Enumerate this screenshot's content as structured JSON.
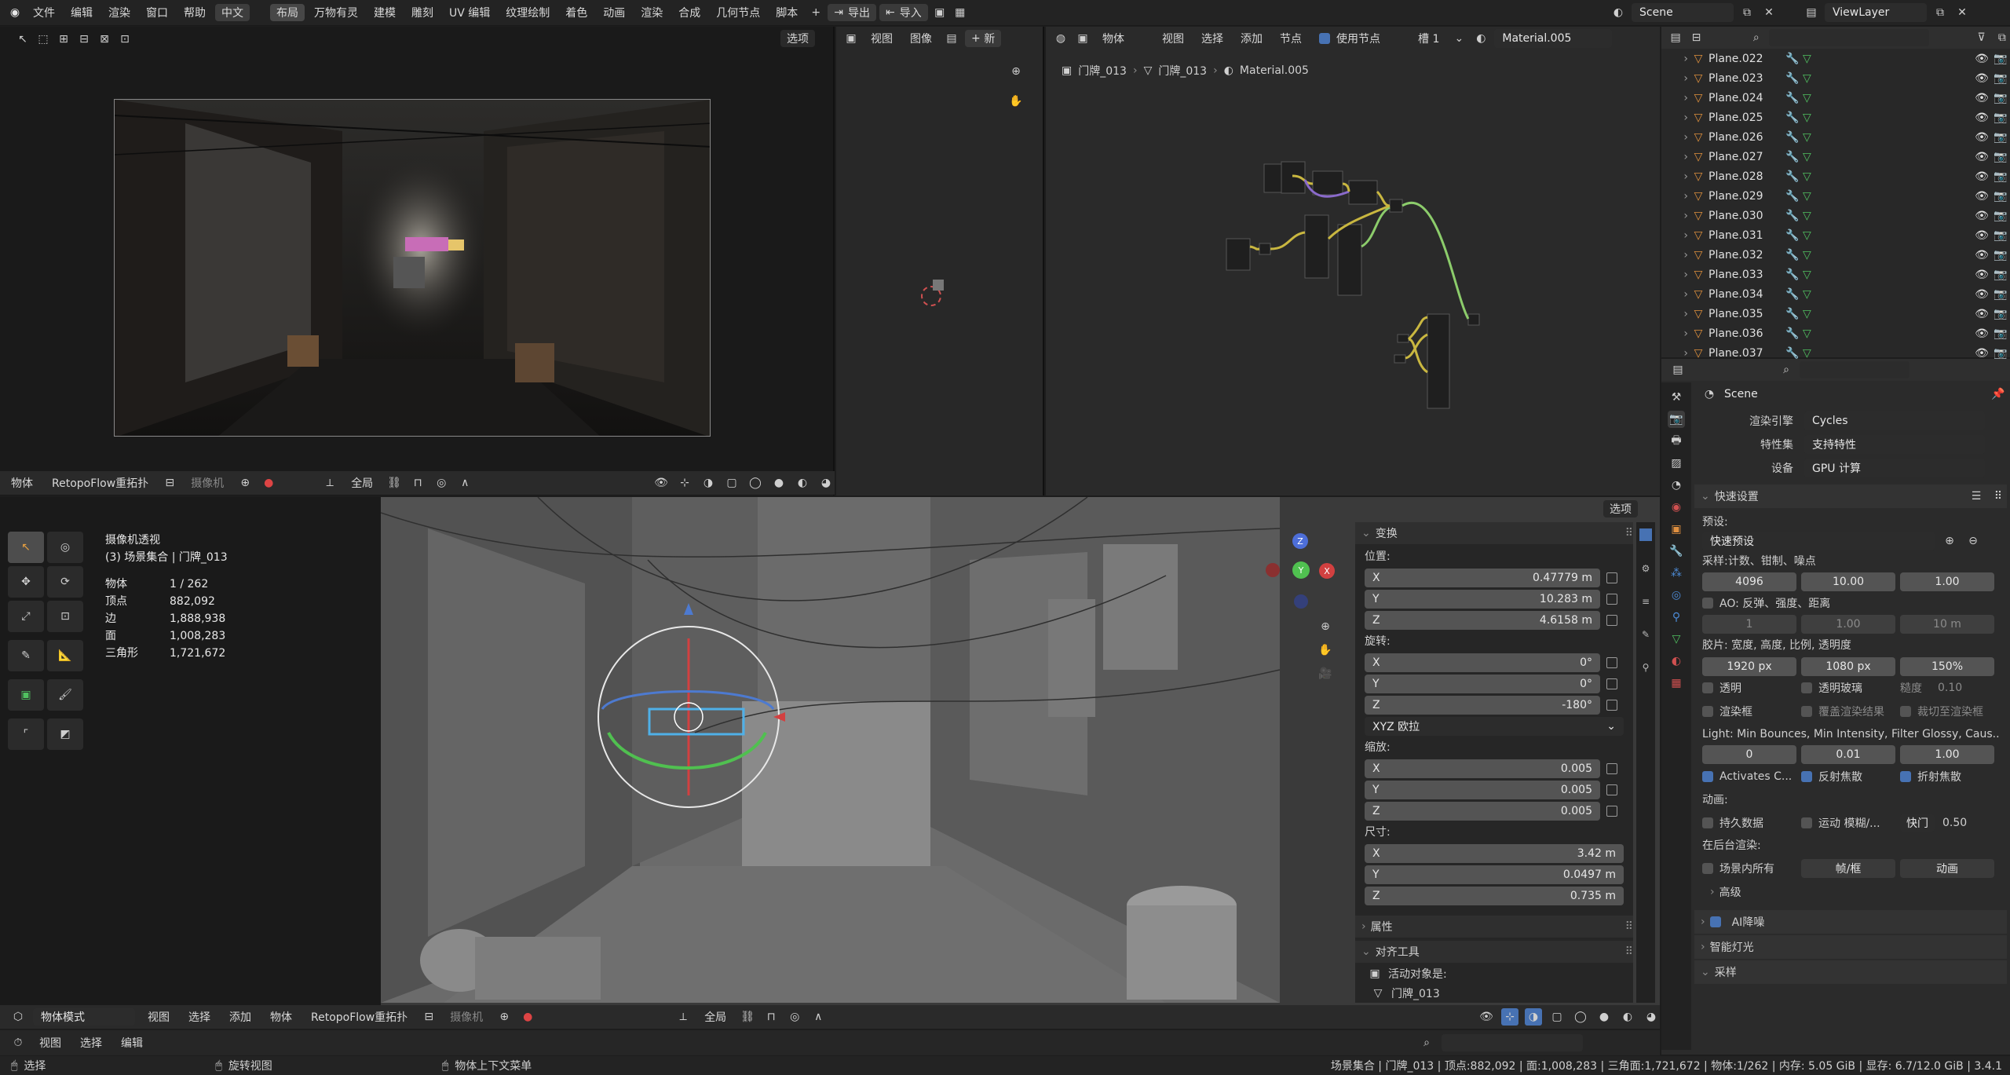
{
  "topbar": {
    "menus": [
      "文件",
      "编辑",
      "渲染",
      "窗口",
      "帮助",
      "中文"
    ],
    "workspaces": [
      "布局",
      "万物有灵",
      "建模",
      "雕刻",
      "UV 编辑",
      "纹理绘制",
      "着色",
      "动画",
      "渲染",
      "合成",
      "几何节点",
      "脚本"
    ],
    "export_label": "导出",
    "import_label": "导入",
    "scene": "Scene",
    "view_layer": "ViewLayer"
  },
  "camera_view": {
    "options_label": "选项",
    "header_items": [
      "物体",
      "RetopoFlow重拓扑",
      "摄像机",
      "全局"
    ]
  },
  "image_editor": {
    "menus": [
      "视图",
      "图像"
    ],
    "new_label": "新"
  },
  "node_editor": {
    "object_type": "物体",
    "menus": [
      "视图",
      "选择",
      "添加",
      "节点"
    ],
    "use_nodes_label": "使用节点",
    "slot": "槽 1",
    "material": "Material.005",
    "breadcrumb": [
      "门牌_013",
      "门牌_013",
      "Material.005"
    ]
  },
  "outliner": {
    "items": [
      "Plane.022",
      "Plane.023",
      "Plane.024",
      "Plane.025",
      "Plane.026",
      "Plane.027",
      "Plane.028",
      "Plane.029",
      "Plane.030",
      "Plane.031",
      "Plane.032",
      "Plane.033",
      "Plane.034",
      "Plane.035",
      "Plane.036",
      "Plane.037"
    ]
  },
  "viewport": {
    "title": "摄像机透视",
    "collection": "(3) 场景集合 | 门牌_013",
    "stats": [
      {
        "label": "物体",
        "value": "1 / 262"
      },
      {
        "label": "顶点",
        "value": "882,092"
      },
      {
        "label": "边",
        "value": "1,888,938"
      },
      {
        "label": "面",
        "value": "1,008,283"
      },
      {
        "label": "三角形",
        "value": "1,721,672"
      }
    ],
    "options_label": "选项"
  },
  "npanel": {
    "transform_title": "变换",
    "location_label": "位置:",
    "location": [
      {
        "axis": "X",
        "value": "0.47779 m"
      },
      {
        "axis": "Y",
        "value": "10.283 m"
      },
      {
        "axis": "Z",
        "value": "4.6158 m"
      }
    ],
    "rotation_label": "旋转:",
    "rotation": [
      {
        "axis": "X",
        "value": "0°"
      },
      {
        "axis": "Y",
        "value": "0°"
      },
      {
        "axis": "Z",
        "value": "-180°"
      }
    ],
    "rotation_mode": "XYZ 欧拉",
    "scale_label": "缩放:",
    "scale": [
      {
        "axis": "X",
        "value": "0.005"
      },
      {
        "axis": "Y",
        "value": "0.005"
      },
      {
        "axis": "Z",
        "value": "0.005"
      }
    ],
    "dimensions_label": "尺寸:",
    "dimensions": [
      {
        "axis": "X",
        "value": "3.42 m"
      },
      {
        "axis": "Y",
        "value": "0.0497 m"
      },
      {
        "axis": "Z",
        "value": "0.735 m"
      }
    ],
    "properties_title": "属性",
    "align_title": "对齐工具",
    "active_object_label": "活动对象是:",
    "active_object": "门牌_013"
  },
  "properties": {
    "scene_name": "Scene",
    "render_engine_label": "渲染引擎",
    "render_engine": "Cycles",
    "feature_set_label": "特性集",
    "feature_set": "支持特性",
    "device_label": "设备",
    "device": "GPU 计算",
    "quick_settings": "快速设置",
    "preset_label": "预设:",
    "preset_value": "快速预设",
    "sampling_label": "采样:计数、钳制、噪点",
    "sampling_values": [
      "4096",
      "10.00",
      "1.00"
    ],
    "ao_label": "AO: 反弹、强度、距离",
    "ao_values": [
      "1",
      "1.00",
      "10 m"
    ],
    "film_label": "胶片: 宽度, 高度, 比例, 透明度",
    "film_values": [
      "1920 px",
      "1080 px",
      "150%"
    ],
    "transparent_label": "透明",
    "transparent_glass_label": "透明玻璃",
    "roughness_label": "糙度",
    "roughness_value": "0.10",
    "render_border_label": "渲染框",
    "overwrite_label": "覆盖渲染结果",
    "crop_label": "裁切至渲染框",
    "light_label": "Light: Min Bounces, Min Intensity, Filter Glossy, Caus...",
    "light_values": [
      "0",
      "0.01",
      "1.00"
    ],
    "activates_label": "Activates C...",
    "reflective_caustics": "反射焦散",
    "refractive_caustics": "折射焦散",
    "animation_label": "动画:",
    "persistent_data": "持久数据",
    "motion_blur": "运动 模糊/...",
    "shutter_label": "快门",
    "shutter_value": "0.50",
    "background_render_label": "在后台渲染:",
    "all_in_scene": "场景内所有",
    "frame_button": "帧/框",
    "animation_button": "动画",
    "advanced": "高级",
    "ai_denoise": "AI降噪",
    "smart_light": "智能灯光",
    "sampling_section": "采样"
  },
  "bottom_header": {
    "mode": "物体模式",
    "menus": [
      "视图",
      "选择",
      "添加",
      "物体"
    ],
    "retopo": "RetopoFlow重拓扑",
    "camera": "摄像机",
    "global": "全局"
  },
  "timeline_header": {
    "menus": [
      "视图",
      "选择",
      "编辑"
    ]
  },
  "statusbar": {
    "select": "选择",
    "rotate": "旋转视图",
    "context": "物体上下文菜单",
    "info": "场景集合 | 门牌_013 | 顶点:882,092 | 面:1,008,283 | 三角面:1,721,672 | 物体:1/262 | 内存: 5.05 GiB | 显存: 6.7/12.0 GiB | 3.4.1"
  }
}
